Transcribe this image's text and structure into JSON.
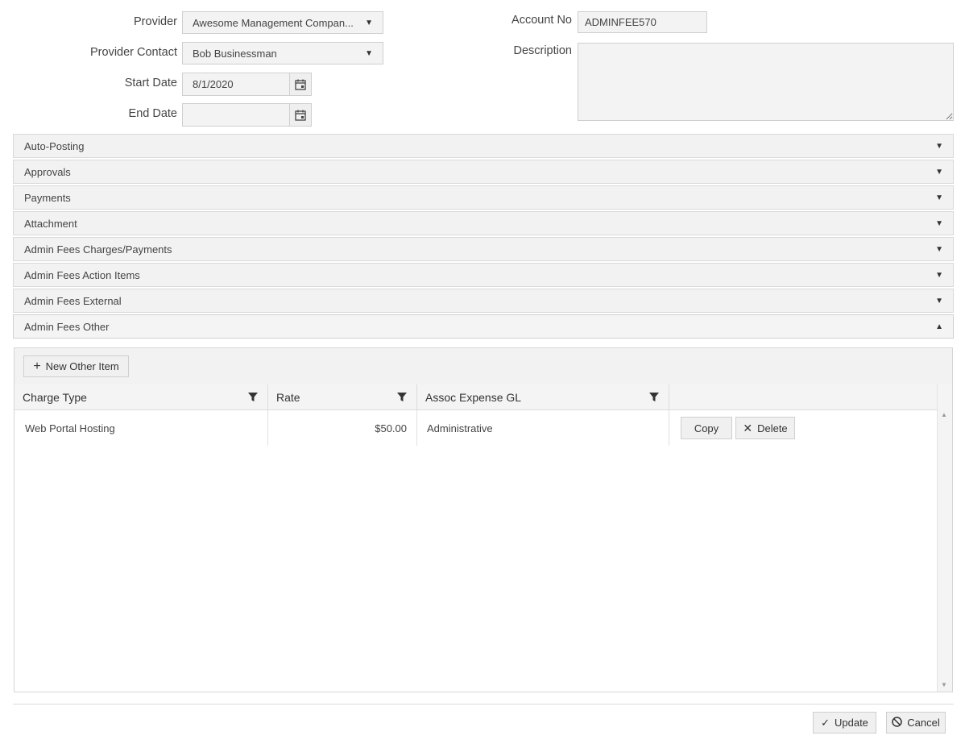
{
  "form": {
    "provider_label": "Provider",
    "provider_value": "Awesome Management Compan...",
    "provider_contact_label": "Provider Contact",
    "provider_contact_value": "Bob Businessman",
    "start_date_label": "Start Date",
    "start_date_value": "8/1/2020",
    "end_date_label": "End Date",
    "end_date_value": "",
    "account_no_label": "Account No",
    "account_no_value": "ADMINFEE570",
    "description_label": "Description",
    "description_value": ""
  },
  "accordion": [
    {
      "label": "Auto-Posting"
    },
    {
      "label": "Approvals"
    },
    {
      "label": "Payments"
    },
    {
      "label": "Attachment"
    },
    {
      "label": "Admin Fees Charges/Payments"
    },
    {
      "label": "Admin Fees Action Items"
    },
    {
      "label": "Admin Fees External"
    },
    {
      "label": "Admin Fees Other"
    }
  ],
  "other_items": {
    "new_button_label": "New Other Item",
    "columns": [
      "Charge Type",
      "Rate",
      "Assoc Expense GL"
    ],
    "rows": [
      {
        "charge_type": "Web Portal Hosting",
        "rate": "$50.00",
        "gl": "Administrative",
        "copy_label": "Copy",
        "delete_label": "Delete"
      }
    ]
  },
  "footer": {
    "update_label": "Update",
    "cancel_label": "Cancel"
  }
}
